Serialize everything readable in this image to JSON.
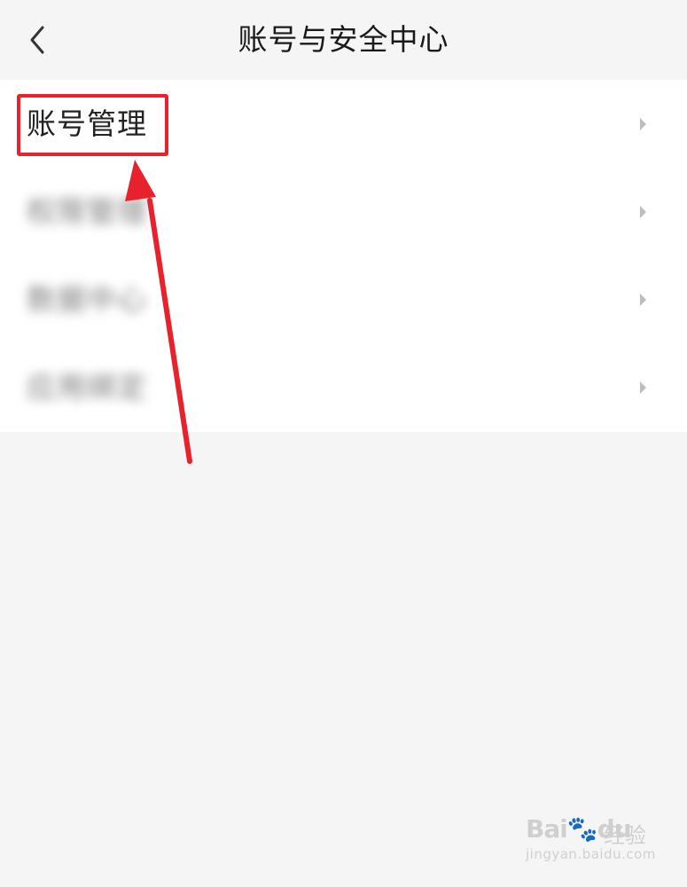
{
  "header": {
    "title": "账号与安全中心"
  },
  "menu": {
    "items": [
      {
        "label": "账号管理",
        "obscured": false
      },
      {
        "label": "权限管理",
        "obscured": true
      },
      {
        "label": "数据中心",
        "obscured": true
      },
      {
        "label": "应用绑定",
        "obscured": true
      }
    ]
  },
  "annotation": {
    "box_color": "#e8222d",
    "arrow_color": "#e8222d"
  },
  "watermark": {
    "logo_text": "Bai",
    "logo_text_2": "du",
    "product_text": "经验",
    "url": "jingyan.baidu.com"
  },
  "colors": {
    "page_background": "#f5f5f5",
    "list_background": "#ffffff",
    "text_primary": "#222222",
    "chevron": "#bdbdbd"
  }
}
